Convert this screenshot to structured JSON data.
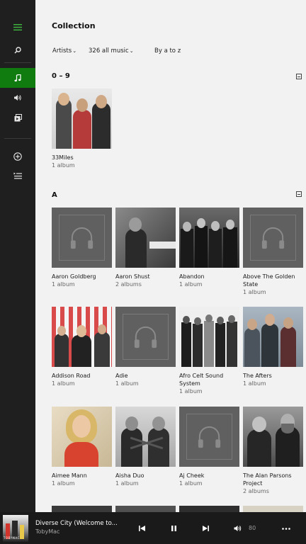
{
  "header": {
    "title": "Collection"
  },
  "filters": {
    "artists": "Artists",
    "count": "326 all music",
    "sort": "By a to z"
  },
  "sections": [
    {
      "heading": "0 – 9"
    },
    {
      "heading": "A"
    }
  ],
  "artists": [
    {
      "name": "33Miles",
      "sub": "1 album"
    },
    {
      "name": "Aaron Goldberg",
      "sub": "1 album"
    },
    {
      "name": "Aaron Shust",
      "sub": "2 albums"
    },
    {
      "name": "Abandon",
      "sub": "1 album"
    },
    {
      "name": "Above The Golden State",
      "sub": "1 album"
    },
    {
      "name": "Addison Road",
      "sub": "1 album"
    },
    {
      "name": "Adie",
      "sub": "1 album"
    },
    {
      "name": "Afro Celt Sound System",
      "sub": "1 album"
    },
    {
      "name": "The Afters",
      "sub": "1 album"
    },
    {
      "name": "Aimee Mann",
      "sub": "1 album"
    },
    {
      "name": "Aisha Duo",
      "sub": "1 album"
    },
    {
      "name": "Aj Cheek",
      "sub": "1 album"
    },
    {
      "name": "The Alan Parsons Project",
      "sub": "2 albums"
    }
  ],
  "player": {
    "track": "Diverse City (Welcome to...",
    "artist": "TobyMac",
    "volume": "80",
    "thumb_text": "TOBYMAC"
  },
  "colors": {
    "accent": "#107c10",
    "sidebar": "#1f1f1f",
    "player": "#1a1a1a"
  }
}
